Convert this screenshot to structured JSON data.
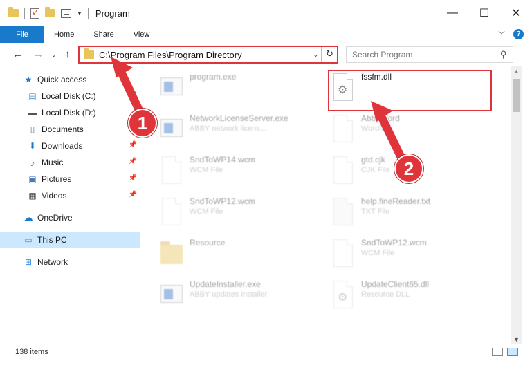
{
  "window": {
    "title": "Program",
    "controls": {
      "minimize": "—",
      "maximize": "☐",
      "close": "✕"
    }
  },
  "ribbon": {
    "tabs": [
      "File",
      "Home",
      "Share",
      "View"
    ],
    "help": "?"
  },
  "address": {
    "path": "C:\\Program Files\\Program Directory",
    "search_placeholder": "Search Program"
  },
  "nav": {
    "quick_access": "Quick access",
    "items": [
      {
        "label": "Local Disk (C:)",
        "icon": "drive-icon",
        "pinned": true
      },
      {
        "label": "Local Disk (D:)",
        "icon": "drive-icon",
        "pinned": false
      },
      {
        "label": "Documents",
        "icon": "documents-icon",
        "pinned": true
      },
      {
        "label": "Downloads",
        "icon": "downloads-icon",
        "pinned": true
      },
      {
        "label": "Music",
        "icon": "music-icon",
        "pinned": true
      },
      {
        "label": "Pictures",
        "icon": "pictures-icon",
        "pinned": true
      },
      {
        "label": "Videos",
        "icon": "videos-icon",
        "pinned": true
      }
    ],
    "onedrive": "OneDrive",
    "this_pc": "This PC",
    "network": "Network"
  },
  "files": [
    {
      "name": "program.exe",
      "sub": "",
      "kind": "exe"
    },
    {
      "name": "fssfm.dll",
      "sub": "",
      "kind": "dll"
    },
    {
      "name": "NetworkLicenseServer.exe",
      "sub": "ABBY network licens...",
      "kind": "exe"
    },
    {
      "name": "AbbyWord",
      "sub": "Wordfile",
      "kind": "doc"
    },
    {
      "name": "SndToWP14.wcm",
      "sub": "WCM File",
      "kind": "doc"
    },
    {
      "name": "gtd.cjk",
      "sub": "CJK File",
      "kind": "doc"
    },
    {
      "name": "SndToWP12.wcm",
      "sub": "WCM File",
      "kind": "doc"
    },
    {
      "name": "help.fineReader.txt",
      "sub": "TXT File",
      "kind": "doc"
    },
    {
      "name": "Resource",
      "sub": "",
      "kind": "folder"
    },
    {
      "name": "SndToWP12.wcm",
      "sub": "WCM File",
      "kind": "doc"
    },
    {
      "name": "UpdateInstaller.exe",
      "sub": "ABBY updates installer",
      "kind": "exe"
    },
    {
      "name": "UpdateClient65.dll",
      "sub": "Resource DLL",
      "kind": "dll"
    }
  ],
  "status": {
    "items": "138 items"
  },
  "callouts": {
    "one": "1",
    "two": "2"
  },
  "colors": {
    "accent": "#1979ca",
    "highlight": "#e0343b",
    "selection": "#cce8ff"
  }
}
